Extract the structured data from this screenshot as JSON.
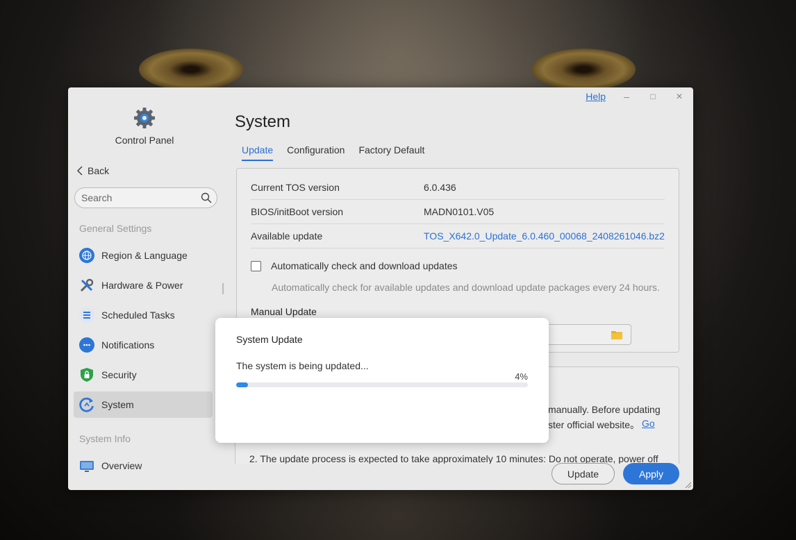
{
  "window": {
    "help_label": "Help",
    "minimize_glyph": "–",
    "maximize_glyph": "□",
    "close_glyph": "✕"
  },
  "sidebar": {
    "app_title": "Control Panel",
    "back_label": "Back",
    "search_placeholder": "Search",
    "general_settings_label": "General Settings",
    "system_info_label": "System Info",
    "items": [
      {
        "label": "Region & Language",
        "icon": "globe-icon"
      },
      {
        "label": "Hardware & Power",
        "icon": "tools-icon"
      },
      {
        "label": "Scheduled Tasks",
        "icon": "tasks-icon"
      },
      {
        "label": "Notifications",
        "icon": "chat-icon"
      },
      {
        "label": "Security",
        "icon": "shield-icon"
      },
      {
        "label": "System",
        "icon": "system-update-icon",
        "active": true
      }
    ],
    "info_items": [
      {
        "label": "Overview",
        "icon": "monitor-icon"
      }
    ]
  },
  "main": {
    "title": "System",
    "tabs": [
      {
        "label": "Update",
        "active": true
      },
      {
        "label": "Configuration"
      },
      {
        "label": "Factory Default"
      }
    ],
    "info": [
      {
        "label": "Current TOS version",
        "value": "6.0.436"
      },
      {
        "label": "BIOS/initBoot version",
        "value": "MADN0101.V05"
      },
      {
        "label": "Available update",
        "value": "TOS_X642.0_Update_6.0.460_00068_2408261046.bz2",
        "link": true
      }
    ],
    "auto_check_label": "Automatically check and download updates",
    "auto_check_desc": "Automatically check for available updates and download update packages every 24 hours.",
    "auto_check_checked": false,
    "manual_update_title": "Manual Update",
    "notes": {
      "line1_visible": "manually. Before updating",
      "line2_visible": "ster official website。",
      "go_link": "Go",
      "line3": "2. The update process is expected to take approximately 10 minutes: Do not operate, power off"
    },
    "buttons": {
      "update": "Update",
      "apply": "Apply"
    }
  },
  "modal": {
    "title": "System Update",
    "message": "The system is being updated...",
    "progress_percent": 4,
    "progress_text": "4%"
  },
  "colors": {
    "accent": "#2d76d8",
    "progress": "#2d8ae8",
    "link": "#2a6fd6"
  }
}
